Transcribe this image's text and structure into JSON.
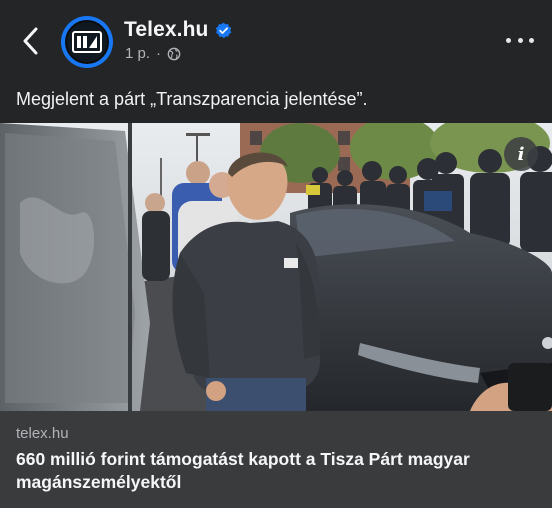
{
  "header": {
    "back_icon": "chevron-left-icon",
    "page_name": "Telex.hu",
    "verified_icon": "verified-badge-icon",
    "timestamp": "1 p.",
    "separator": "·",
    "audience_icon": "globe-icon",
    "more_icon": "more-horizontal-icon",
    "avatar_logo_icon": "telex-logo-icon"
  },
  "post": {
    "text": "Megjelent a párt „Transzparencia jelentése”."
  },
  "photo": {
    "info_label": "i",
    "info_icon": "info-icon"
  },
  "link_preview": {
    "domain": "telex.hu",
    "title": "660 millió forint támogatást kapott a Tisza Párt magyar magánszemélyektől"
  },
  "colors": {
    "background": "#242526",
    "card": "#3a3b3c",
    "accent": "#1877f2",
    "text_primary": "#f5f6f7",
    "text_secondary": "#b0b3b8"
  }
}
